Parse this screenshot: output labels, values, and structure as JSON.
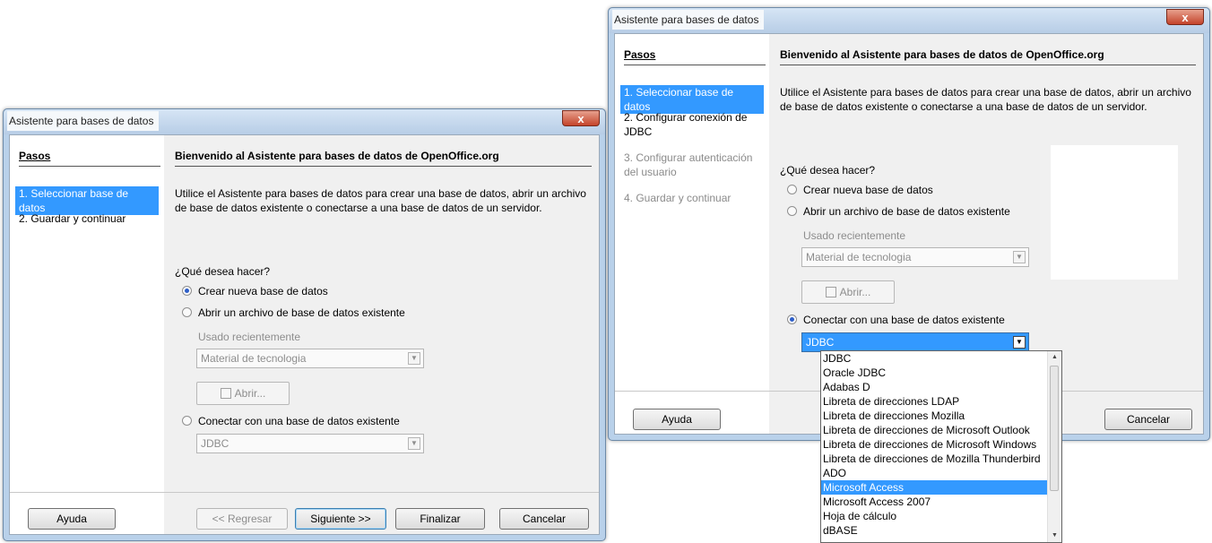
{
  "left_window": {
    "title": "Asistente para bases de datos",
    "close_symbol": "x",
    "steps_title": "Pasos",
    "steps": [
      {
        "label": "1. Seleccionar base de datos",
        "active": true
      },
      {
        "label": "2. Guardar y continuar",
        "active": false
      }
    ],
    "main_title": "Bienvenido al Asistente para bases de datos de OpenOffice.org",
    "intro": "Utilice el Asistente para bases de datos para crear una base de datos, abrir un archivo de base de datos existente o conectarse a una base de datos de un servidor.",
    "question": "¿Qué desea hacer?",
    "radio_create": "Crear nueva base de datos",
    "radio_open": "Abrir un archivo de base de datos existente",
    "recent_label": "Usado recientemente",
    "recent_value": "Material de tecnologia",
    "open_button": "Abrir...",
    "radio_connect": "Conectar con una base de datos existente",
    "connect_value": "JDBC",
    "buttons": {
      "help": "Ayuda",
      "back": "<< Regresar",
      "next": "Siguiente >>",
      "finish": "Finalizar",
      "cancel": "Cancelar"
    }
  },
  "right_window": {
    "title": "Asistente para bases de datos",
    "close_symbol": "x",
    "steps_title": "Pasos",
    "steps": [
      {
        "label": "1. Seleccionar base de datos",
        "state": "active"
      },
      {
        "label": "2. Configurar conexión de JDBC",
        "state": "normal"
      },
      {
        "label": "3. Configurar autenticación del usuario",
        "state": "disabled"
      },
      {
        "label": "4. Guardar y continuar",
        "state": "disabled"
      }
    ],
    "main_title": "Bienvenido al Asistente para bases de datos de OpenOffice.org",
    "intro": "Utilice el Asistente para bases de datos para crear una base de datos, abrir un archivo de base de datos existente o conectarse a una base de datos de un servidor.",
    "question": "¿Qué desea hacer?",
    "radio_create": "Crear nueva base de datos",
    "radio_open": "Abrir un archivo de base de datos existente",
    "recent_label": "Usado recientemente",
    "recent_value": "Material de tecnologia",
    "open_button": "Abrir...",
    "radio_connect": "Conectar con una base de datos existente",
    "connect_value": "JDBC",
    "buttons": {
      "help": "Ayuda",
      "cancel": "Cancelar"
    },
    "dropdown_options": [
      "JDBC",
      "Oracle JDBC",
      "Adabas D",
      "Libreta de direcciones LDAP",
      "Libreta de direcciones Mozilla",
      "Libreta de direcciones de Microsoft Outlook",
      "Libreta de direcciones de Microsoft Windows",
      "Libreta de direcciones de Mozilla Thunderbird",
      "ADO",
      "Microsoft Access",
      "Microsoft Access 2007",
      "Hoja de cálculo",
      "dBASE"
    ],
    "dropdown_selected": "Microsoft Access"
  },
  "colors": {
    "selection": "#3399ff",
    "window_frame": "#b9d1ea",
    "dialog_bg": "#f0f0f0",
    "close_button": "#c4442b"
  }
}
